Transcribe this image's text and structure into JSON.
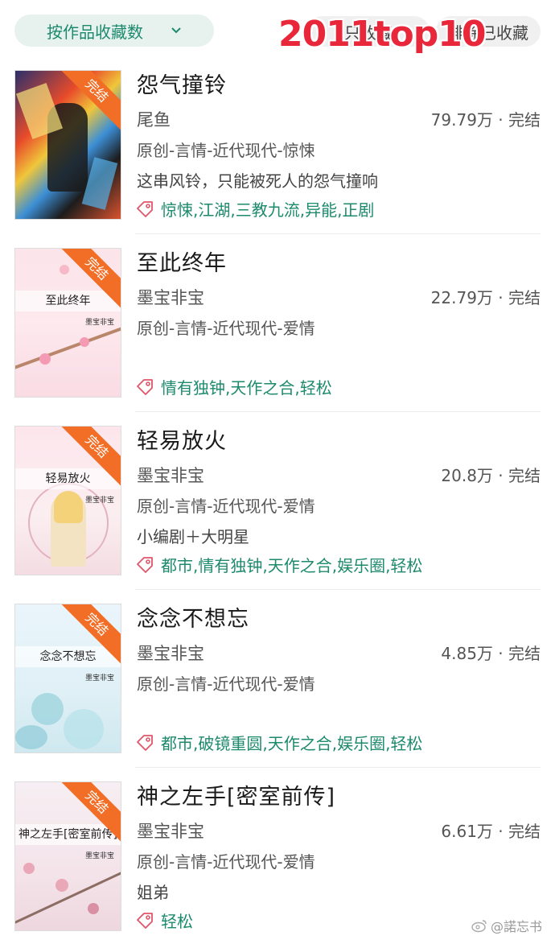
{
  "filter": {
    "sort_label": "按作品收藏数",
    "pill_1_label": "只收藏",
    "pill_2_label": "排除已收藏"
  },
  "overlay_title": "2011top10",
  "books": [
    {
      "title": "怨气撞铃",
      "author": "尾鱼",
      "stats": "79.79万 · 完结",
      "genre": "原创-言情-近代现代-惊悚",
      "desc": "这串风铃，只能被死人的怨气撞响",
      "tags": "惊悚,江湖,三教九流,异能,正剧",
      "cover_badge": "完结",
      "cover_title": "",
      "cover_author": ""
    },
    {
      "title": "至此终年",
      "author": "墨宝非宝",
      "stats": "22.79万 · 完结",
      "genre": "原创-言情-近代现代-爱情",
      "desc": "",
      "tags": "情有独钟,天作之合,轻松",
      "cover_badge": "完结",
      "cover_title": "至此终年",
      "cover_author": "墨宝非宝"
    },
    {
      "title": "轻易放火",
      "author": "墨宝非宝",
      "stats": "20.8万 · 完结",
      "genre": "原创-言情-近代现代-爱情",
      "desc": "小编剧＋大明星",
      "tags": "都市,情有独钟,天作之合,娱乐圈,轻松",
      "cover_badge": "完结",
      "cover_title": "轻易放火",
      "cover_author": "墨宝非宝"
    },
    {
      "title": "念念不想忘",
      "author": "墨宝非宝",
      "stats": "4.85万 · 完结",
      "genre": "原创-言情-近代现代-爱情",
      "desc": "",
      "tags": "都市,破镜重圆,天作之合,娱乐圈,轻松",
      "cover_badge": "完结",
      "cover_title": "念念不想忘",
      "cover_author": "墨宝非宝"
    },
    {
      "title": "神之左手[密室前传]",
      "author": "墨宝非宝",
      "stats": "6.61万 · 完结",
      "genre": "原创-言情-近代现代-爱情",
      "desc": "姐弟",
      "tags": "轻松",
      "cover_badge": "完结",
      "cover_title": "神之左手[密室前传]",
      "cover_author": "墨宝非宝"
    }
  ],
  "watermark": "@諾忘书",
  "colors": {
    "accent": "#1d8a6c",
    "accent_bg": "#e7f2ef",
    "overlay_red": "#e8283a",
    "badge_orange": "#f26d25"
  }
}
